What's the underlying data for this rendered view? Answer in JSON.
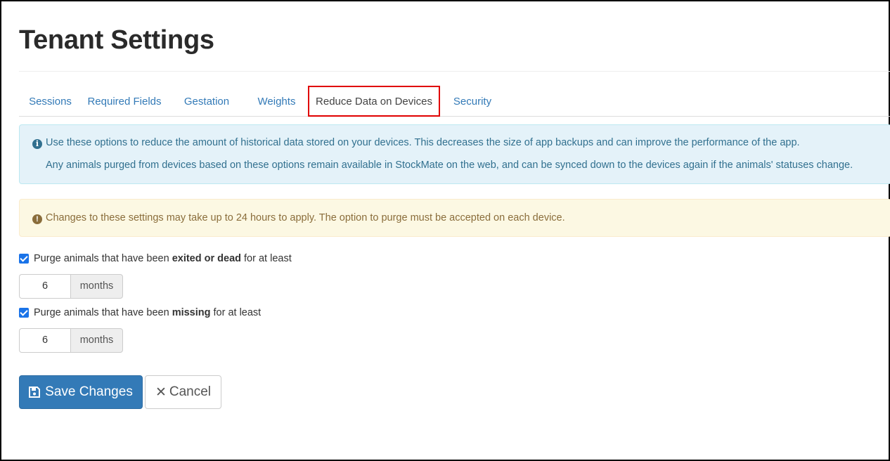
{
  "page": {
    "title": "Tenant Settings"
  },
  "tabs": [
    {
      "label": "Sessions"
    },
    {
      "label": "Required Fields"
    },
    {
      "label": "Gestation"
    },
    {
      "label": "Weights"
    },
    {
      "label": "Reduce Data on Devices",
      "active": true
    },
    {
      "label": "Security"
    }
  ],
  "info_alert": {
    "icon": "info-circle-icon",
    "line1": "Use these options to reduce the amount of historical data stored on your devices. This decreases the size of app backups and can improve the performance of the app.",
    "line2": "Any animals purged from devices based on these options remain available in StockMate on the web, and can be synced down to the devices again if the animals' statuses change."
  },
  "warning_alert": {
    "icon": "exclamation-circle-icon",
    "text": "Changes to these settings may take up to 24 hours to apply. The option to purge must be accepted on each device."
  },
  "purge_exited": {
    "checked": true,
    "label_prefix": "Purge animals that have been ",
    "label_bold": "exited or dead",
    "label_suffix": " for at least",
    "value": "6",
    "unit": "months"
  },
  "purge_missing": {
    "checked": true,
    "label_prefix": "Purge animals that have been ",
    "label_bold": "missing",
    "label_suffix": " for at least",
    "value": "6",
    "unit": "months"
  },
  "actions": {
    "save_label": "Save Changes",
    "cancel_label": "Cancel"
  },
  "colors": {
    "link": "#337ab7",
    "primary_button": "#337ab7",
    "highlight_border": "#e00000",
    "info_bg": "#e4f2f9",
    "warning_bg": "#fcf8e3"
  }
}
